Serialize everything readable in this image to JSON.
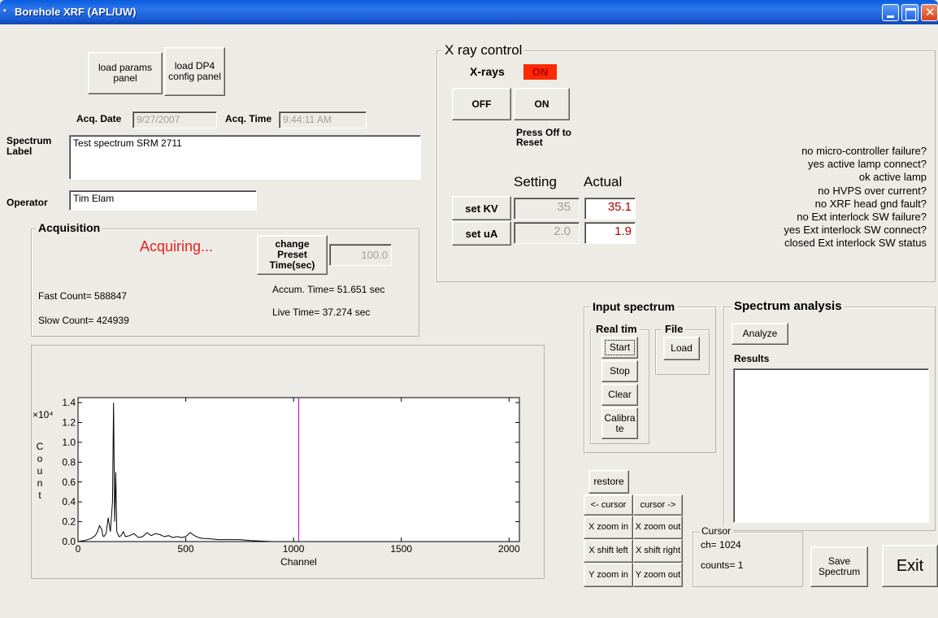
{
  "window": {
    "title": "Borehole XRF (APL/UW)"
  },
  "top_buttons": {
    "load_params": "load params panel",
    "load_dp4": "load DP4 config panel"
  },
  "acq": {
    "date_label": "Acq. Date",
    "date_value": "9/27/2007",
    "time_label": "Acq. Time",
    "time_value": "9:44:11 AM"
  },
  "spectrum_label": {
    "label": "Spectrum Label",
    "value": "Test spectrum  SRM 2711"
  },
  "operator": {
    "label": "Operator",
    "value": "Tim Elam"
  },
  "acquisition": {
    "title": "Acquisition",
    "status": "Acquiring...",
    "change_preset_label": "change Preset Time(sec)",
    "preset_value": "100.0",
    "accum_time": "Accum. Time=  51.651 sec",
    "live_time": "Live Time=  37.274 sec",
    "fast_count": "Fast Count= 588847",
    "slow_count": "Slow Count= 424939"
  },
  "xray": {
    "title": "X ray control",
    "xrays_label": "X-rays",
    "state": "ON",
    "state_color": "#ff2a00",
    "off_button": "OFF",
    "on_button": "ON",
    "reset_note": "Press Off to Reset",
    "setting_header": "Setting",
    "actual_header": "Actual",
    "set_kv_button": "set KV",
    "set_ua_button": "set uA",
    "kv_setting": "35",
    "ua_setting": "2.0",
    "kv_actual": "35.1",
    "ua_actual": "1.9",
    "actual_color": "#b00000",
    "status": [
      {
        "value": "no",
        "label": "micro-controller failure?"
      },
      {
        "value": "yes",
        "label": "active lamp connect?"
      },
      {
        "value": "ok",
        "label": "active lamp"
      },
      {
        "value": "no",
        "label": "HVPS over current?"
      },
      {
        "value": "no",
        "label": "XRF head gnd fault?"
      },
      {
        "value": "no",
        "label": "Ext interlock SW failure?"
      },
      {
        "value": "yes",
        "label": "Ext interlock SW connect?"
      },
      {
        "value": "closed",
        "label": "Ext interlock SW status"
      }
    ]
  },
  "input_spectrum": {
    "title": "Input spectrum",
    "realtime_title": "Real tim",
    "file_title": "File",
    "start": "Start",
    "stop": "Stop",
    "clear": "Clear",
    "calibrate": "Calibra te",
    "load": "Load"
  },
  "analysis": {
    "title": "Spectrum analysis",
    "analyze": "Analyze",
    "results_label": "Results",
    "results_value": ""
  },
  "plot_controls": {
    "restore": "restore",
    "cursor_left": "<- cursor",
    "cursor_right": "cursor ->",
    "x_zoom_in": "X zoom in",
    "x_zoom_out": "X zoom out",
    "x_shift_left": "X shift left",
    "x_shift_right": "X shift right",
    "y_zoom_in": "Y zoom in",
    "y_zoom_out": "Y zoom out"
  },
  "cursor": {
    "title": "Cursor",
    "ch": "ch= 1024",
    "counts": "counts= 1"
  },
  "save_button": "Save Spectrum",
  "exit_button": "Exit",
  "chart_data": {
    "type": "line",
    "xlabel": "Channel",
    "ylabel": "C o u n t",
    "y_multiplier": "×10⁴",
    "xlim": [
      0,
      2048
    ],
    "ylim": [
      0,
      1.45
    ],
    "x_ticks": [
      0,
      500,
      1000,
      1500,
      2000
    ],
    "y_ticks": [
      0.0,
      0.2,
      0.4,
      0.6,
      0.8,
      1.0,
      1.2,
      1.4
    ],
    "y_tick_labels": [
      "0.0",
      "0.2",
      "0.4",
      "0.6",
      "0.8",
      "1.0",
      "1.2",
      "1.4"
    ],
    "cursor_channel": 1024,
    "cursor_color": "#cc00cc",
    "series": [
      {
        "x": [
          0,
          30,
          60,
          80,
          90,
          100,
          110,
          115,
          120,
          130,
          140,
          150,
          160,
          165,
          170,
          175,
          180,
          190,
          200,
          210,
          220,
          240,
          260,
          280,
          300,
          320,
          340,
          360,
          380,
          400,
          420,
          440,
          460,
          480,
          500,
          520,
          540,
          560,
          580,
          600,
          650,
          700,
          750,
          800,
          850,
          900,
          1000,
          1200,
          1500,
          2048
        ],
        "y": [
          0.0,
          0.01,
          0.03,
          0.06,
          0.1,
          0.16,
          0.12,
          0.06,
          0.05,
          0.08,
          0.24,
          0.1,
          0.4,
          1.4,
          0.2,
          0.7,
          0.1,
          0.05,
          0.06,
          0.1,
          0.05,
          0.06,
          0.08,
          0.04,
          0.05,
          0.09,
          0.06,
          0.08,
          0.07,
          0.05,
          0.06,
          0.04,
          0.05,
          0.04,
          0.05,
          0.09,
          0.06,
          0.04,
          0.03,
          0.03,
          0.02,
          0.02,
          0.02,
          0.01,
          0.005,
          0.0,
          0.0,
          0.0,
          0.0,
          0.0
        ]
      }
    ]
  }
}
